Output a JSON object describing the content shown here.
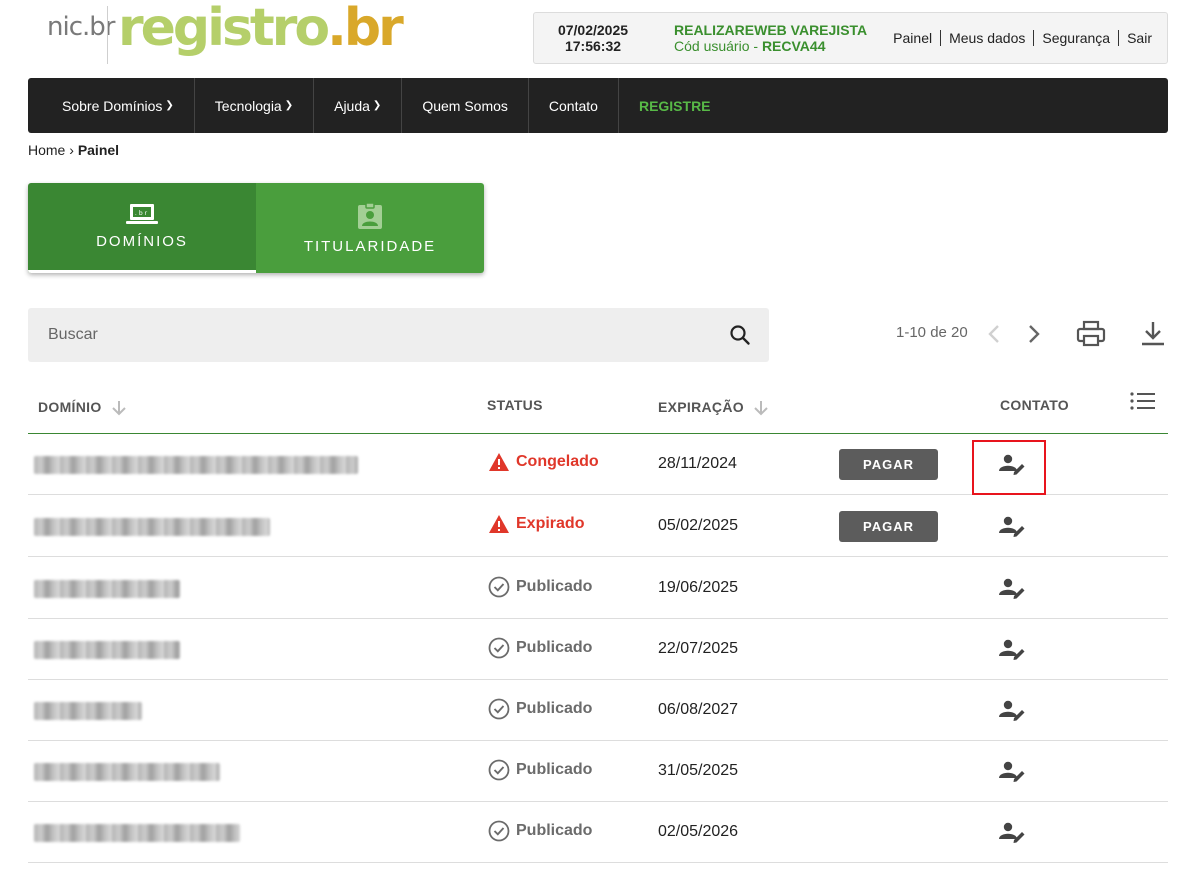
{
  "header": {
    "logo_small": "nic.br",
    "logo_main": "registro",
    "logo_suffix": ".br",
    "date": "07/02/2025",
    "time": "17:56:32",
    "org_name": "REALIZAREWEB VAREJISTA",
    "user_code_label": "Cód usuário -",
    "user_code": "RECVA44",
    "links": [
      "Painel",
      "Meus dados",
      "Segurança",
      "Sair"
    ]
  },
  "nav": {
    "items": [
      {
        "label": "Sobre Domínios",
        "dropdown": true
      },
      {
        "label": "Tecnologia",
        "dropdown": true
      },
      {
        "label": "Ajuda",
        "dropdown": true
      },
      {
        "label": "Quem Somos",
        "dropdown": false
      },
      {
        "label": "Contato",
        "dropdown": false
      },
      {
        "label": "REGISTRE",
        "dropdown": false
      }
    ]
  },
  "breadcrumb": {
    "home": "Home",
    "separator": "›",
    "current": "Painel"
  },
  "tabs": [
    {
      "label": "DOMÍNIOS",
      "active": true,
      "icon": "laptop-br-icon"
    },
    {
      "label": "TITULARIDADE",
      "active": false,
      "icon": "badge-person-icon"
    }
  ],
  "search": {
    "placeholder": "Buscar",
    "value": ""
  },
  "pagination": {
    "text": "1-10 de 20"
  },
  "table": {
    "headers": {
      "domain": "DOMÍNIO",
      "status": "STATUS",
      "expiration": "EXPIRAÇÃO",
      "contact": "CONTATO"
    },
    "pay_label": "PAGAR",
    "rows": [
      {
        "status": "Congelado",
        "status_type": "warning",
        "expiration": "28/11/2024",
        "pay": true
      },
      {
        "status": "Expirado",
        "status_type": "warning",
        "expiration": "05/02/2025",
        "pay": true
      },
      {
        "status": "Publicado",
        "status_type": "ok",
        "expiration": "19/06/2025",
        "pay": false
      },
      {
        "status": "Publicado",
        "status_type": "ok",
        "expiration": "22/07/2025",
        "pay": false
      },
      {
        "status": "Publicado",
        "status_type": "ok",
        "expiration": "06/08/2027",
        "pay": false
      },
      {
        "status": "Publicado",
        "status_type": "ok",
        "expiration": "31/05/2025",
        "pay": false
      },
      {
        "status": "Publicado",
        "status_type": "ok",
        "expiration": "02/05/2026",
        "pay": false
      }
    ]
  },
  "colors": {
    "brand_green": "#3a8733",
    "tab_green": "#4a9e3d",
    "warning_red": "#e0372a",
    "highlight_red": "#e8141d",
    "nav_bg": "#222222"
  }
}
